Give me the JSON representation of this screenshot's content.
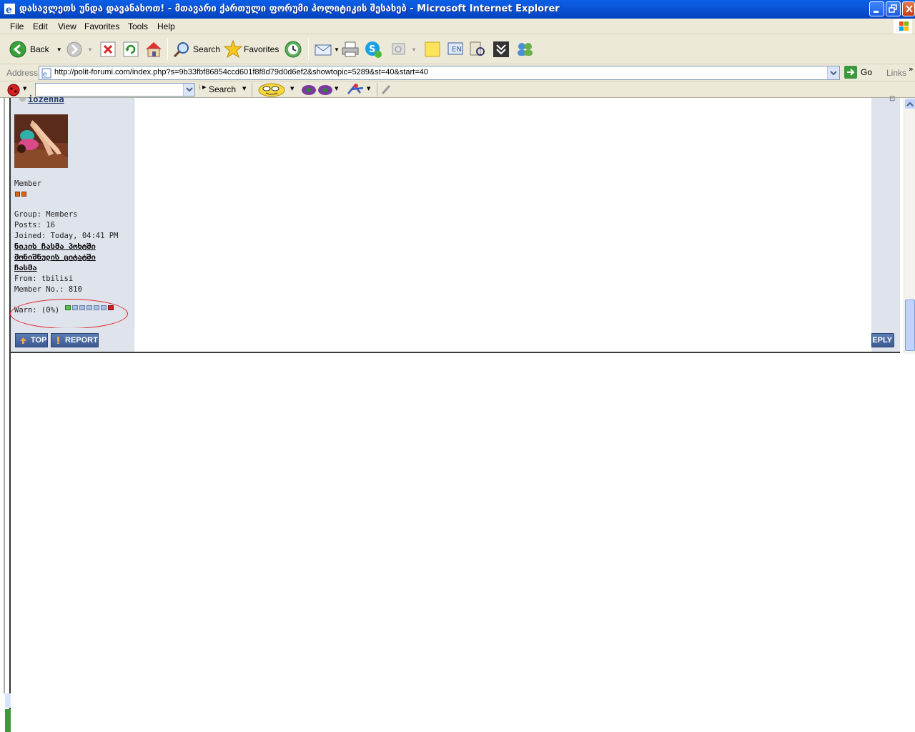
{
  "window": {
    "title": "დასავლეთს უნდა დავანახოთ! - მთავარი ქართული ფორუმი პოლიტიკის შესახებ - Microsoft Internet Explorer"
  },
  "menu": [
    "File",
    "Edit",
    "View",
    "Favorites",
    "Tools",
    "Help"
  ],
  "toolbar": {
    "back_label": "Back",
    "search_label": "Search",
    "favorites_label": "Favorites"
  },
  "address": {
    "label": "Address",
    "url": "http://polit-forumi.com/index.php?s=9b33fbf86854ccd601f8f8d79d0d6ef2&showtopic=5289&st=40&start=40",
    "go_label": "Go",
    "links_label": "Links"
  },
  "toolbar2": {
    "search_label": "Search"
  },
  "profile": {
    "username": "iozenna",
    "rank": "Member",
    "rank_pips": 2,
    "group": "Group: Members",
    "posts": "Posts: 16",
    "joined": "Joined: Today, 04:41 PM",
    "link_lines": [
      "ნიკის ჩასმა პოხტში",
      "მონიშნულის ციტატში",
      "ჩასმა"
    ],
    "from": "From: tbilisi",
    "member_no": "Member No.: 810",
    "warn_label": "Warn: (0%)",
    "warn_level": 0
  },
  "buttons": {
    "top_label": "TOP",
    "report_label": "REPORT",
    "reply_label": "REPLY"
  },
  "colors": {
    "titlebar": "#0a5fe8",
    "panel": "#dfe3ec",
    "button": "#3b5a92",
    "annotation": "#e02020"
  }
}
